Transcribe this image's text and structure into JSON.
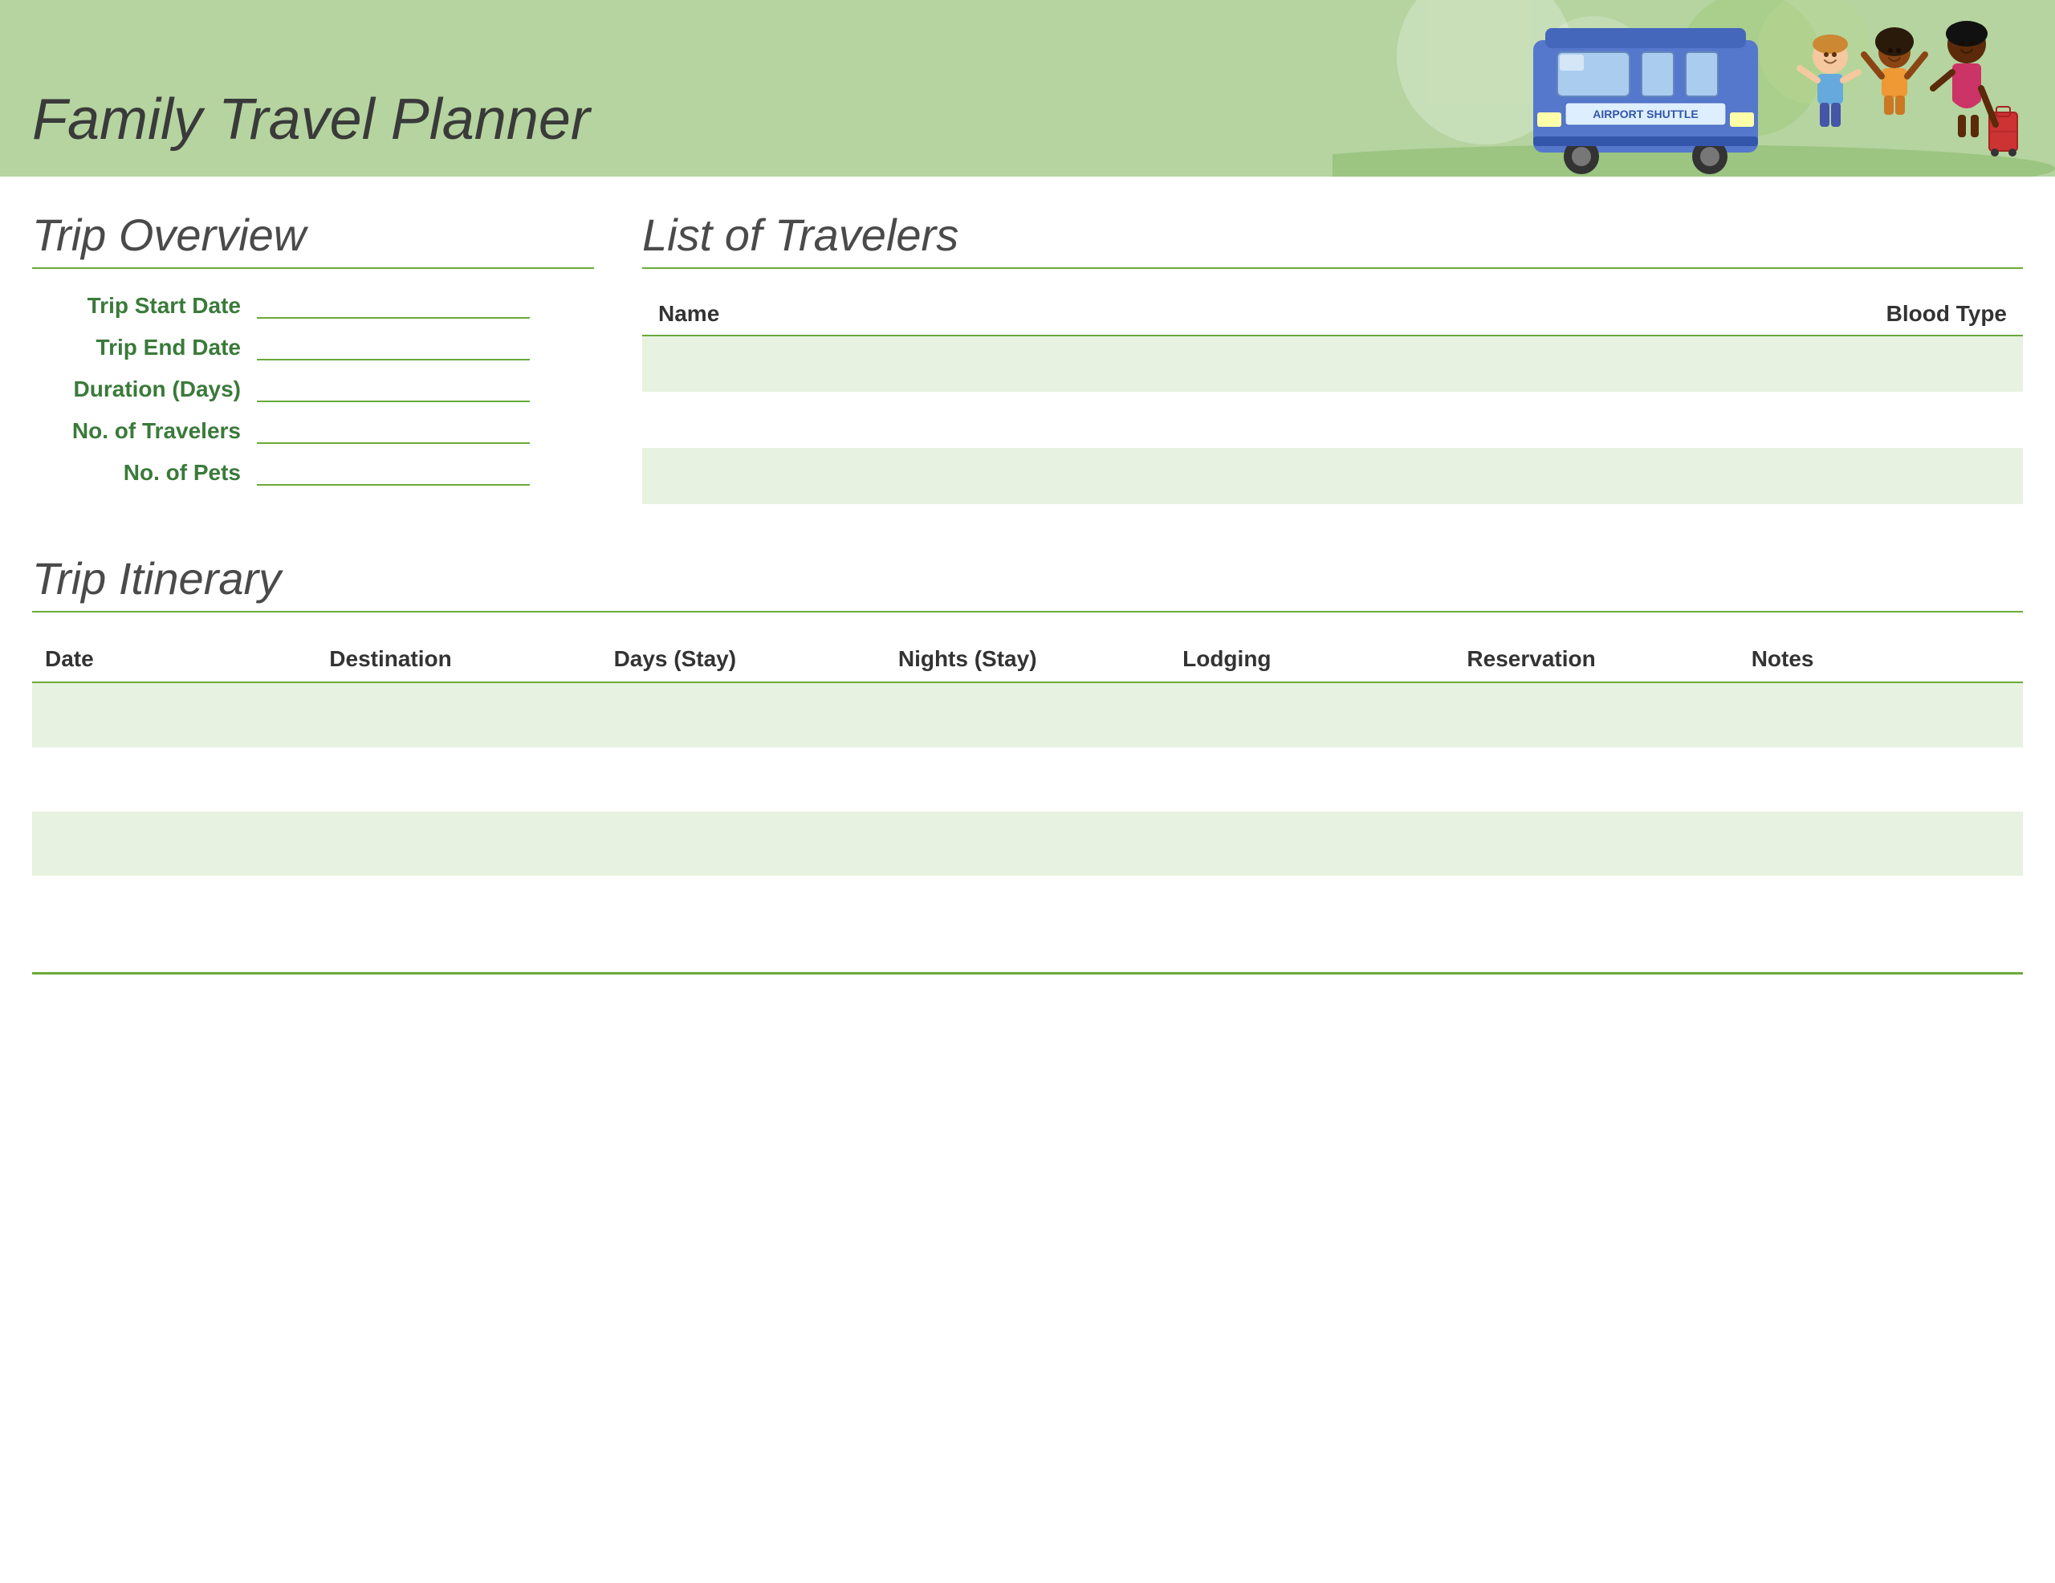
{
  "header": {
    "title": "Family Travel Planner"
  },
  "tripOverview": {
    "sectionTitle": "Trip Overview",
    "fields": [
      {
        "id": "trip-start-date",
        "label": "Trip Start Date"
      },
      {
        "id": "trip-end-date",
        "label": "Trip End Date"
      },
      {
        "id": "duration-days",
        "label": "Duration (Days)"
      },
      {
        "id": "no-of-travelers",
        "label": "No. of Travelers"
      },
      {
        "id": "no-of-pets",
        "label": "No. of Pets"
      }
    ]
  },
  "travelers": {
    "sectionTitle": "List of Travelers",
    "columns": [
      "Name",
      "Blood Type"
    ],
    "rows": [
      {
        "name": "",
        "bloodType": ""
      },
      {
        "name": "",
        "bloodType": ""
      },
      {
        "name": "",
        "bloodType": ""
      }
    ]
  },
  "itinerary": {
    "sectionTitle": "Trip Itinerary",
    "columns": [
      "Date",
      "Destination",
      "Days (Stay)",
      "Nights (Stay)",
      "Lodging",
      "Reservation",
      "Notes"
    ],
    "rows": [
      {
        "date": "",
        "destination": "",
        "daysStay": "",
        "nightsStay": "",
        "lodging": "",
        "reservation": "",
        "notes": ""
      },
      {
        "date": "",
        "destination": "",
        "daysStay": "",
        "nightsStay": "",
        "lodging": "",
        "reservation": "",
        "notes": ""
      },
      {
        "date": "",
        "destination": "",
        "daysStay": "",
        "nightsStay": "",
        "lodging": "",
        "reservation": "",
        "notes": ""
      },
      {
        "date": "",
        "destination": "",
        "daysStay": "",
        "nightsStay": "",
        "lodging": "",
        "reservation": "",
        "notes": ""
      }
    ]
  },
  "colors": {
    "headerBg": "#b5d4a0",
    "accent": "#6aaa3a",
    "labelColor": "#3a7a3a",
    "titleColor": "#4a4a4a",
    "rowLight": "#e8f2e0"
  }
}
